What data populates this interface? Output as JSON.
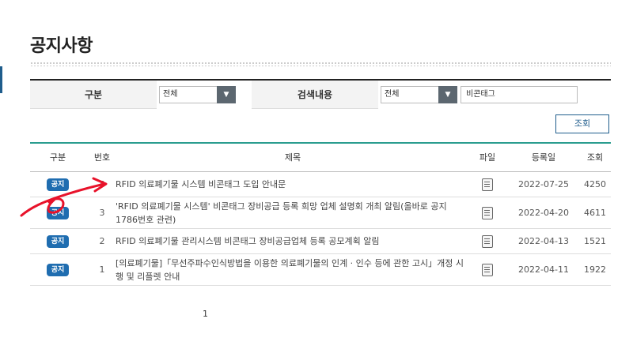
{
  "page": {
    "title": "공지사항"
  },
  "search": {
    "category_label": "구분",
    "category_value": "전체",
    "field_label": "검색내용",
    "field_value": "전체",
    "keyword": "비콘태그",
    "button_label": "조회"
  },
  "table": {
    "headers": {
      "category": "구분",
      "number": "번호",
      "title": "제목",
      "file": "파일",
      "date": "등록일",
      "views": "조회"
    },
    "rows": [
      {
        "badge": "공지",
        "number": "4",
        "title": "RFID 의료폐기물 시스템 비콘태그 도입 안내문",
        "date": "2022-07-25",
        "views": "4250"
      },
      {
        "badge": "공지",
        "number": "3",
        "title": "'RFID 의료폐기물 시스템' 비콘태그 장비공급 등록 희망 업체 설명회 개최 알림(올바로 공지 1786번호 관련)",
        "date": "2022-04-20",
        "views": "4611"
      },
      {
        "badge": "공지",
        "number": "2",
        "title": "RFID 의료폐기물 관리시스템 비콘태그 장비공급업체 등록 공모계획 알림",
        "date": "2022-04-13",
        "views": "1521"
      },
      {
        "badge": "공지",
        "number": "1",
        "title": "[의료폐기물]「무선주파수인식방법을 이용한 의료폐기물의 인계 · 인수 등에 관한 고시」개정 시행 및 리플렛 안내",
        "date": "2022-04-11",
        "views": "1922"
      }
    ]
  },
  "pagination": {
    "current": "1"
  },
  "colors": {
    "accent": "#1f6db0",
    "annotation": "#e8122a",
    "table_top_border": "#2a9d8f"
  },
  "icons": {
    "file": "document-icon",
    "dropdown": "triangle-down-icon"
  }
}
